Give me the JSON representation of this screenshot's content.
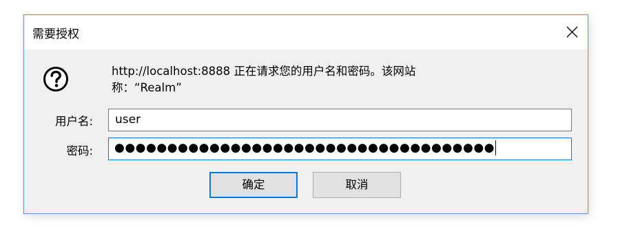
{
  "dialog": {
    "title": "需要授权",
    "close_icon": "close-icon",
    "help_icon": "question-mark-circle-icon",
    "message_line1": "http://localhost:8888 正在请求您的用户名和密码。该网站",
    "message_line2": "称：“Realm”",
    "username_label": "用户名:",
    "username_value": "user",
    "password_label": "密码:",
    "password_value": "●●●●●●●●●●●●●●●●●●●●●●●●●●●●●●●●●●●●",
    "ok_label": "确定",
    "cancel_label": "取消"
  },
  "colors": {
    "accent": "#0078d7",
    "dialog_border": "#7a9cc4",
    "dialog_bg": "#f0f0f0"
  }
}
